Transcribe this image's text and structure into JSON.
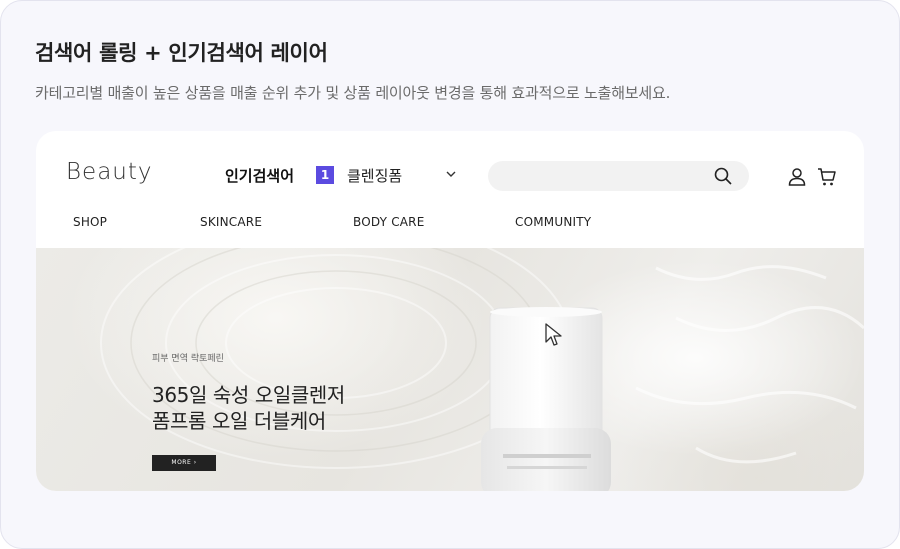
{
  "page": {
    "title": "검색어 롤링 + 인기검색어 레이어",
    "description": "카테고리별 매출이 높은 상품을 매출 순위 추가 및 상품 레이아웃 변경을 통해 효과적으로 노출해보세요."
  },
  "header": {
    "logo": "Beauty",
    "popular_label": "인기검색어",
    "rank": "1",
    "keyword": "클렌징폼",
    "search": {
      "placeholder": ""
    },
    "icons": [
      "chevron-down-icon",
      "search-icon",
      "user-icon",
      "cart-icon"
    ]
  },
  "nav": {
    "items": [
      "SHOP",
      "SKINCARE",
      "BODY CARE",
      "COMMUNITY"
    ]
  },
  "hero": {
    "subtitle": "피부 면역 락토페린",
    "title_line1": "365일 숙성 오일클렌저",
    "title_line2": "폼프롬 오일 더블케어",
    "button": "MORE"
  },
  "colors": {
    "accent": "#5b4be0",
    "button_bg": "#222222",
    "page_bg": "#f7f7fc"
  }
}
